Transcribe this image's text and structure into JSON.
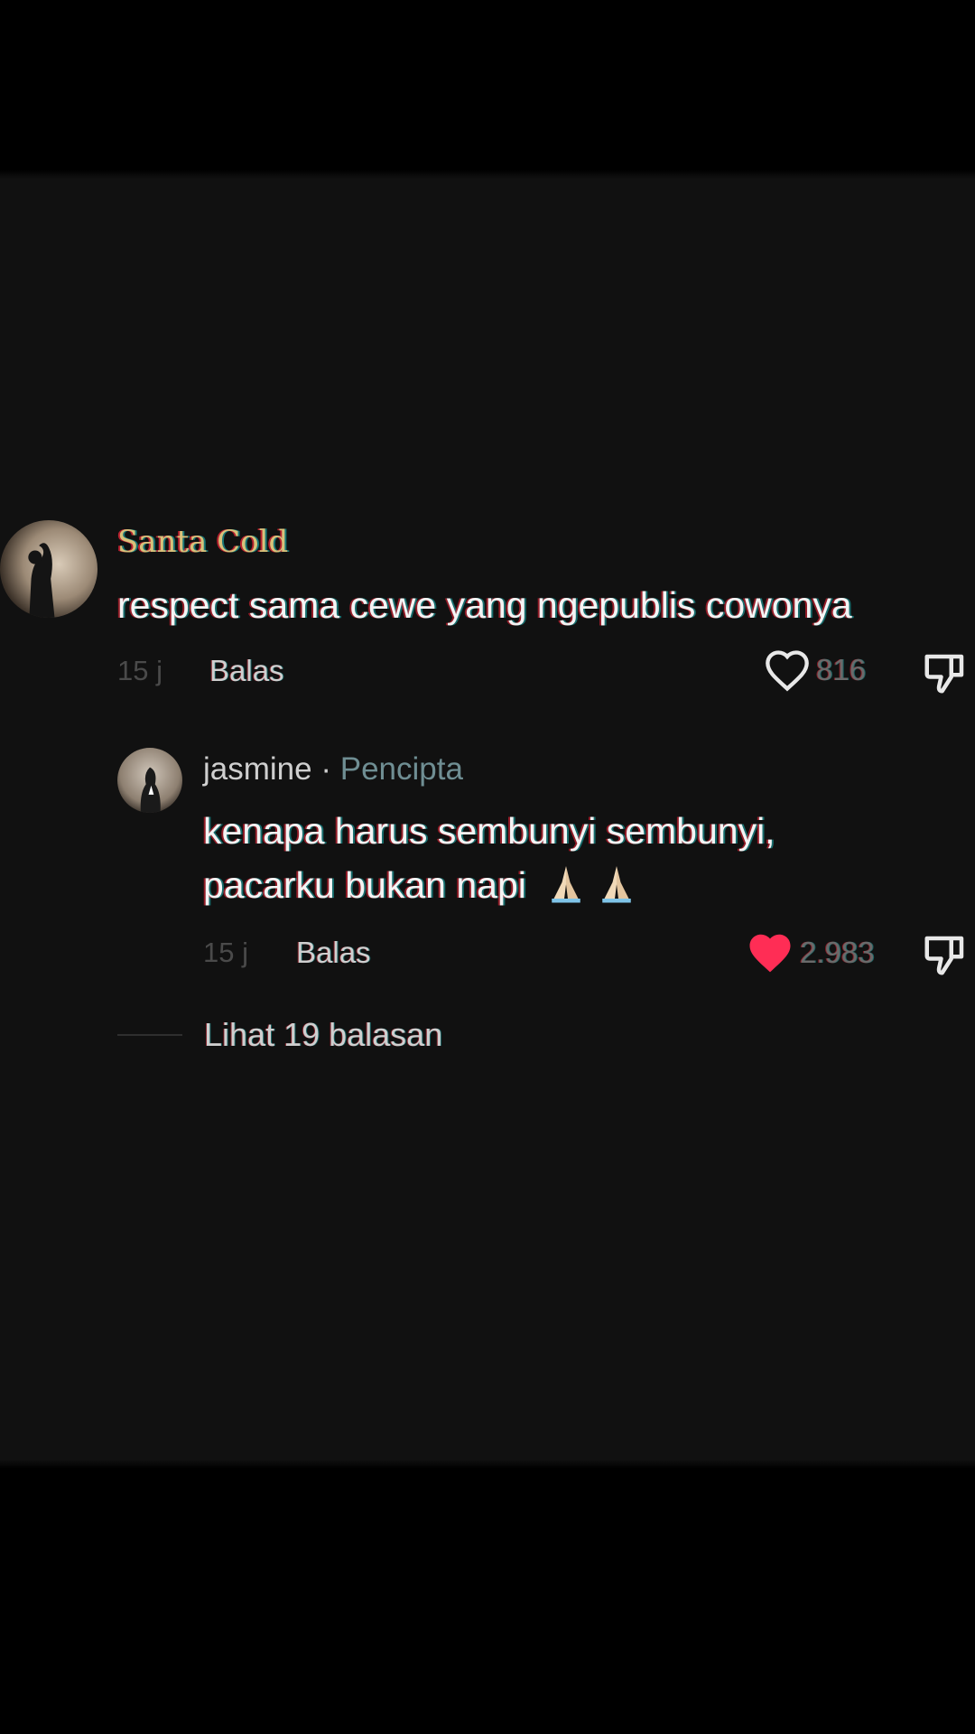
{
  "comment": {
    "username": "Santa Cold",
    "text": "respect sama cewe yang ngepublis cowonya",
    "time": "15 j",
    "reply_label": "Balas",
    "likes": "816",
    "liked": false
  },
  "reply": {
    "username": "jasmine",
    "separator": " · ",
    "badge": "Pencipta",
    "text_line1": "kenapa harus sembunyi sembunyi,",
    "text_line2": "pacarku bukan napi",
    "time": "15 j",
    "reply_label": "Balas",
    "likes": "2.983",
    "liked": true
  },
  "view_replies_label": "Lihat 19 balasan",
  "colors": {
    "background": "#111111",
    "letterbox": "#000000",
    "liked_heart": "#ff2d55",
    "badge": "#6f8e93"
  },
  "icons": [
    "avatar",
    "heart-outline-icon",
    "heart-filled-icon",
    "dislike-icon",
    "folded-hands-emoji"
  ]
}
